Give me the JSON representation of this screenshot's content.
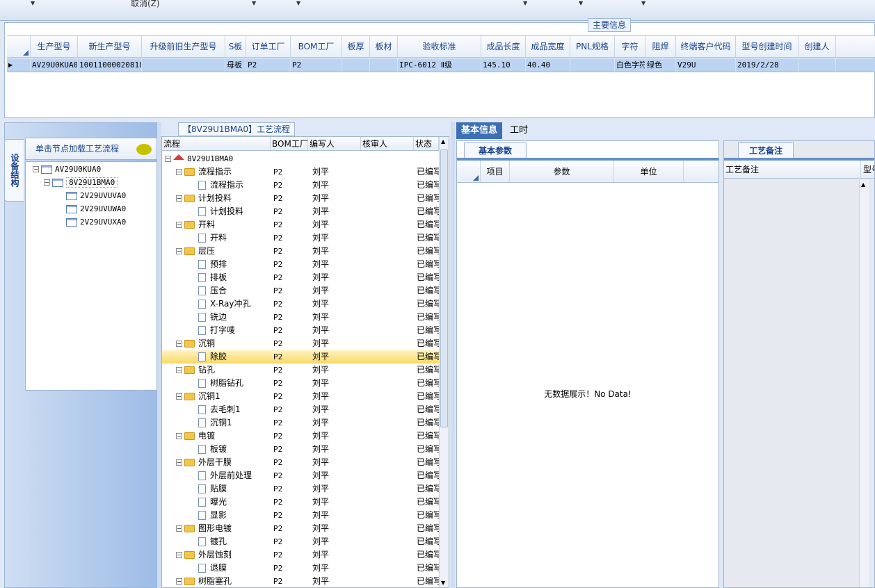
{
  "toolbar": {
    "cancel_label": "取消(Z)"
  },
  "main_info": {
    "title": "主要信息",
    "columns": [
      "生产型号",
      "新生产型号",
      "升级前旧生产型号",
      "S板",
      "订单工厂",
      "BOM工厂",
      "板厚",
      "板材",
      "验收标准",
      "成品长度",
      "成品宽度",
      "PNL规格",
      "字符",
      "阻焊",
      "终端客户代码",
      "型号创建时间",
      "创建人"
    ],
    "row": [
      "AV29U0KUA0",
      "10011000020818",
      "",
      "母板",
      "P2",
      "P2",
      "",
      "",
      "IPC-6012 Ⅱ级",
      "145.10",
      "40.40",
      "",
      "白色字符",
      "绿色",
      "V29U",
      "2019/2/28",
      ""
    ]
  },
  "left_panel": {
    "vertical_tab": "设备结构",
    "tree_title": "单击节点加载工艺流程",
    "tree": [
      "AV29U0KUA0",
      "8V29U1BMA0",
      "2V29UVUVA0",
      "2V29UVUWA0",
      "2V29UVUXA0"
    ]
  },
  "flow_panel": {
    "caption": "【8V29U1BMA0】工艺流程",
    "columns": [
      "流程",
      "BOM工厂",
      "编写人",
      "核审人",
      "状态"
    ],
    "root": "8V29U1BMA0",
    "rows": [
      {
        "level": 1,
        "name": "流程指示",
        "bom": "P2",
        "writer": "刘平",
        "reviewer": "",
        "status": "已编写"
      },
      {
        "level": 2,
        "name": "流程指示",
        "bom": "P2",
        "writer": "刘平",
        "reviewer": "",
        "status": "已编写"
      },
      {
        "level": 1,
        "name": "计划投料",
        "bom": "P2",
        "writer": "刘平",
        "reviewer": "",
        "status": "已编写"
      },
      {
        "level": 2,
        "name": "计划投料",
        "bom": "P2",
        "writer": "刘平",
        "reviewer": "",
        "status": "已编写"
      },
      {
        "level": 1,
        "name": "开料",
        "bom": "P2",
        "writer": "刘平",
        "reviewer": "",
        "status": "已编写"
      },
      {
        "level": 2,
        "name": "开料",
        "bom": "P2",
        "writer": "刘平",
        "reviewer": "",
        "status": "已编写"
      },
      {
        "level": 1,
        "name": "层压",
        "bom": "P2",
        "writer": "刘平",
        "reviewer": "",
        "status": "已编写"
      },
      {
        "level": 2,
        "name": "预排",
        "bom": "P2",
        "writer": "刘平",
        "reviewer": "",
        "status": "已编写"
      },
      {
        "level": 2,
        "name": "排板",
        "bom": "P2",
        "writer": "刘平",
        "reviewer": "",
        "status": "已编写"
      },
      {
        "level": 2,
        "name": "压合",
        "bom": "P2",
        "writer": "刘平",
        "reviewer": "",
        "status": "已编写"
      },
      {
        "level": 2,
        "name": "X-Ray冲孔",
        "bom": "P2",
        "writer": "刘平",
        "reviewer": "",
        "status": "已编写"
      },
      {
        "level": 2,
        "name": "铣边",
        "bom": "P2",
        "writer": "刘平",
        "reviewer": "",
        "status": "已编写"
      },
      {
        "level": 2,
        "name": "打字唛",
        "bom": "P2",
        "writer": "刘平",
        "reviewer": "",
        "status": "已编写"
      },
      {
        "level": 1,
        "name": "沉铜",
        "bom": "P2",
        "writer": "刘平",
        "reviewer": "",
        "status": "已编写"
      },
      {
        "level": 2,
        "name": "除胶",
        "bom": "P2",
        "writer": "刘平",
        "reviewer": "",
        "status": "已编写",
        "selected": true
      },
      {
        "level": 1,
        "name": "钻孔",
        "bom": "P2",
        "writer": "刘平",
        "reviewer": "",
        "status": "已编写"
      },
      {
        "level": 2,
        "name": "树脂钻孔",
        "bom": "P2",
        "writer": "刘平",
        "reviewer": "",
        "status": "已编写"
      },
      {
        "level": 1,
        "name": "沉铜1",
        "bom": "P2",
        "writer": "刘平",
        "reviewer": "",
        "status": "已编写"
      },
      {
        "level": 2,
        "name": "去毛刺1",
        "bom": "P2",
        "writer": "刘平",
        "reviewer": "",
        "status": "已编写"
      },
      {
        "level": 2,
        "name": "沉铜1",
        "bom": "P2",
        "writer": "刘平",
        "reviewer": "",
        "status": "已编写"
      },
      {
        "level": 1,
        "name": "电镀",
        "bom": "P2",
        "writer": "刘平",
        "reviewer": "",
        "status": "已编写"
      },
      {
        "level": 2,
        "name": "板镀",
        "bom": "P2",
        "writer": "刘平",
        "reviewer": "",
        "status": "已编写"
      },
      {
        "level": 1,
        "name": "外层干膜",
        "bom": "P2",
        "writer": "刘平",
        "reviewer": "",
        "status": "已编写"
      },
      {
        "level": 2,
        "name": "外层前处理",
        "bom": "P2",
        "writer": "刘平",
        "reviewer": "",
        "status": "已编写"
      },
      {
        "level": 2,
        "name": "贴膜",
        "bom": "P2",
        "writer": "刘平",
        "reviewer": "",
        "status": "已编写"
      },
      {
        "level": 2,
        "name": "曝光",
        "bom": "P2",
        "writer": "刘平",
        "reviewer": "",
        "status": "已编写"
      },
      {
        "level": 2,
        "name": "显影",
        "bom": "P2",
        "writer": "刘平",
        "reviewer": "",
        "status": "已编写"
      },
      {
        "level": 1,
        "name": "图形电镀",
        "bom": "P2",
        "writer": "刘平",
        "reviewer": "",
        "status": "已编写"
      },
      {
        "level": 2,
        "name": "镀孔",
        "bom": "P2",
        "writer": "刘平",
        "reviewer": "",
        "status": "已编写"
      },
      {
        "level": 1,
        "name": "外层蚀刻",
        "bom": "P2",
        "writer": "刘平",
        "reviewer": "",
        "status": "已编写"
      },
      {
        "level": 2,
        "name": "退膜",
        "bom": "P2",
        "writer": "刘平",
        "reviewer": "",
        "status": "已编写"
      },
      {
        "level": 1,
        "name": "树脂塞孔",
        "bom": "P2",
        "writer": "刘平",
        "reviewer": "",
        "status": "已编写"
      }
    ]
  },
  "right_tabs": [
    "基本信息",
    "工时"
  ],
  "basic_params": {
    "tab": "基本参数",
    "columns": [
      "项目",
      "参数",
      "单位"
    ],
    "empty_text": "无数据展示！No Data!"
  },
  "remarks": {
    "tab": "工艺备注",
    "column": "工艺备注",
    "next_column": "型号"
  },
  "colors": {
    "selection": "#bcd4f2",
    "tab_active": "#3d6fb6",
    "row_highlight": "#fbd865"
  }
}
